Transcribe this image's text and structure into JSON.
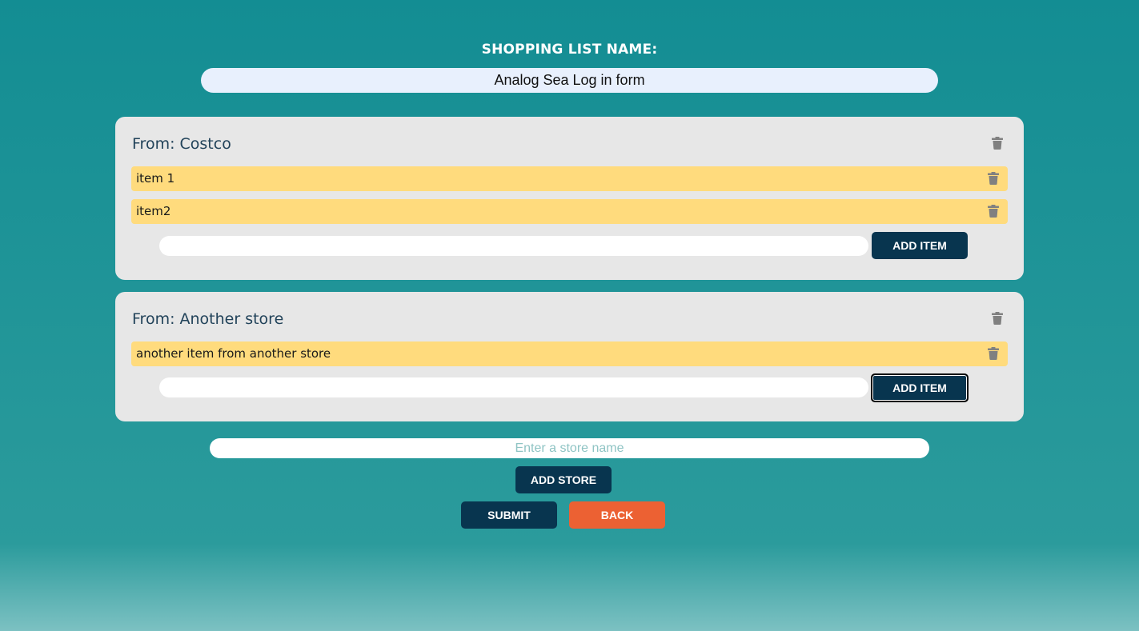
{
  "list_name": {
    "label": "SHOPPING LIST NAME:",
    "value": "Analog Sea Log in form"
  },
  "stores": [
    {
      "title": "From: Costco",
      "items": [
        "item 1",
        "item2"
      ],
      "item_input_value": "",
      "add_item_label": "ADD ITEM"
    },
    {
      "title": "From: Another store",
      "items": [
        "another item from another store"
      ],
      "item_input_value": "",
      "add_item_label": "ADD ITEM"
    }
  ],
  "new_store": {
    "placeholder": "Enter a store name",
    "add_store_label": "ADD STORE"
  },
  "actions": {
    "submit_label": "SUBMIT",
    "back_label": "BACK"
  },
  "colors": {
    "background": "#138d93",
    "card": "#e7e7e7",
    "item_highlight": "#ffdb7d",
    "primary_button": "#08354f",
    "back_button": "#ec6133",
    "icon": "#808080"
  },
  "icons": {
    "delete": "trash-icon"
  }
}
